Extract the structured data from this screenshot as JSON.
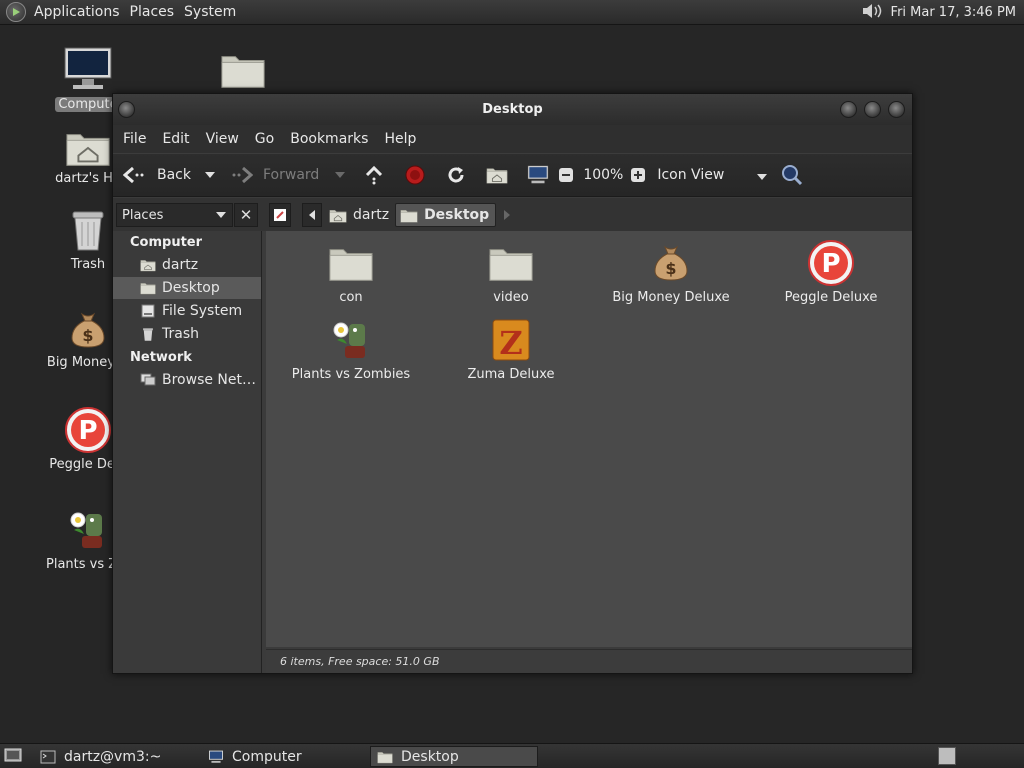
{
  "top_panel": {
    "menus": [
      "Applications",
      "Places",
      "System"
    ],
    "clock": "Fri Mar 17,  3:46 PM"
  },
  "desktop": {
    "icons": [
      {
        "label": "Compute",
        "icon": "computer-icon",
        "selected": true
      },
      {
        "label": "",
        "icon": "folder-icon"
      },
      {
        "label": "dartz's Ho",
        "icon": "home-folder-icon"
      },
      {
        "label": "Trash",
        "icon": "trash-icon"
      },
      {
        "label": "Big Money D",
        "icon": "money-bag-icon"
      },
      {
        "label": "Peggle Delu",
        "icon": "peggle-icon"
      },
      {
        "label": "Plants vs Zor",
        "icon": "plants-vs-zombies-icon"
      }
    ]
  },
  "window": {
    "title": "Desktop",
    "menubar": [
      "File",
      "Edit",
      "View",
      "Go",
      "Bookmarks",
      "Help"
    ],
    "toolbar": {
      "back": "Back",
      "forward": "Forward",
      "zoom": "100%",
      "view_mode": "Icon View"
    },
    "side_pane_selector": "Places",
    "breadcrumbs": [
      "dartz",
      "Desktop"
    ],
    "sidebar": {
      "sections": [
        {
          "heading": "Computer",
          "items": [
            "dartz",
            "Desktop",
            "File System",
            "Trash"
          ]
        },
        {
          "heading": "Network",
          "items": [
            "Browse Net…"
          ]
        }
      ],
      "selected": "Desktop"
    },
    "files": [
      {
        "name": "con",
        "icon": "folder-icon"
      },
      {
        "name": "video",
        "icon": "folder-icon"
      },
      {
        "name": "Big Money Deluxe",
        "icon": "money-bag-icon"
      },
      {
        "name": "Peggle Deluxe",
        "icon": "peggle-icon"
      },
      {
        "name": "Plants vs Zombies",
        "icon": "plants-vs-zombies-icon"
      },
      {
        "name": "Zuma Deluxe",
        "icon": "zuma-icon"
      }
    ],
    "status": "6 items, Free space: 51.0 GB"
  },
  "taskbar": {
    "tasks": [
      {
        "label": "dartz@vm3:~",
        "icon": "terminal-icon"
      },
      {
        "label": "Computer",
        "icon": "computer-icon"
      },
      {
        "label": "Desktop",
        "icon": "folder-icon",
        "active": true
      }
    ]
  }
}
